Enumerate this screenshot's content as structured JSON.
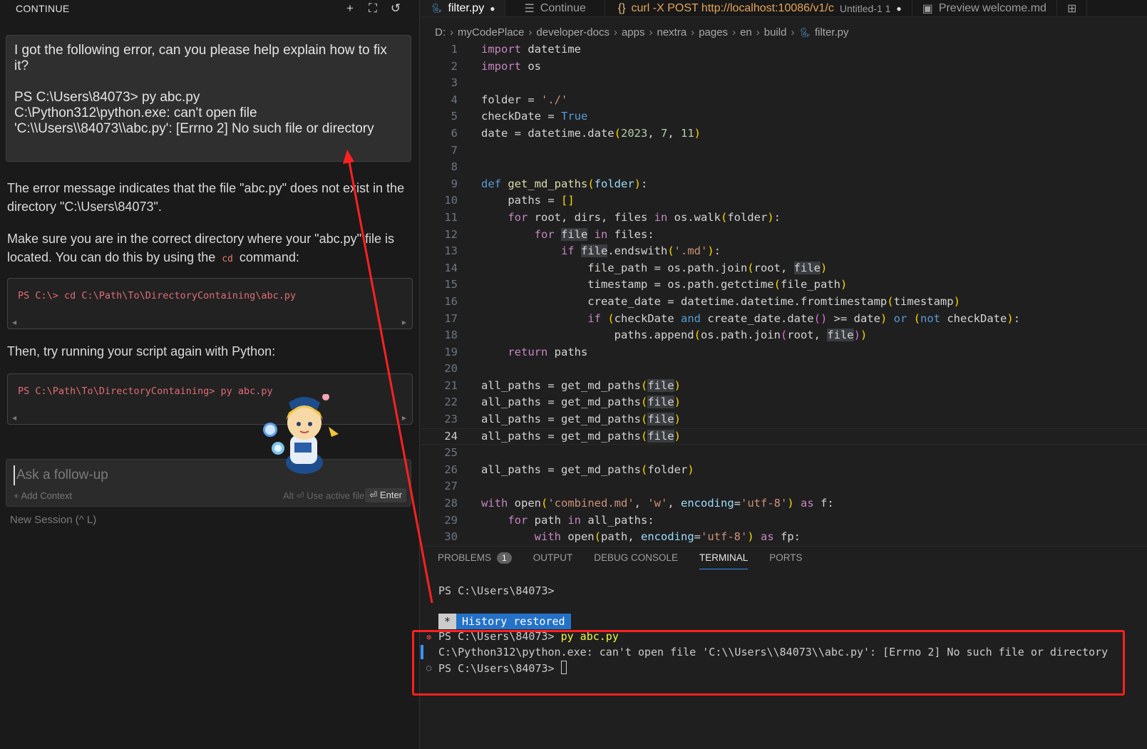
{
  "continue_panel": {
    "title": "CONTINUE",
    "actions": [
      {
        "name": "new-session-icon",
        "glyph": "+"
      },
      {
        "name": "fullscreen-icon",
        "glyph": "⛶"
      },
      {
        "name": "history-icon",
        "glyph": "↺"
      }
    ],
    "user_message": {
      "line1": "I got the following error, can you please help explain how to fix it?",
      "line2": "PS C:\\Users\\84073> py abc.py",
      "line3": "C:\\Python312\\python.exe: can't open file",
      "line4": "'C:\\\\Users\\\\84073\\\\abc.py': [Errno 2] No such file or directory"
    },
    "answer": {
      "p1": "The error message indicates that the file \"abc.py\" does not exist in the directory \"C:\\Users\\84073\".",
      "p2_a": "Make sure you are in the correct directory where your \"abc.py\" file is located. You can do this by using the ",
      "p2_code": "cd",
      "p2_b": " command:",
      "code1": "PS C:\\> cd C:\\Path\\To\\DirectoryContaining\\abc.py",
      "p3": "Then, try running your script again with Python:",
      "code2": "PS C:\\Path\\To\\DirectoryContaining> py abc.py"
    },
    "followup": {
      "placeholder": "Ask a follow-up",
      "add_context": "+ Add Context",
      "use_active_file": "Alt ⏎ Use active file",
      "enter": "⏎ Enter"
    },
    "new_session": "New Session (^ L)"
  },
  "editor": {
    "tabs": [
      {
        "label": "filter.py",
        "icon": "python-icon",
        "modified": true,
        "active": true
      },
      {
        "label": "Continue",
        "icon": "list-icon",
        "active": false
      },
      {
        "label": "curl -X POST http://localhost:10086/v1/c",
        "sub": "Untitled-1 1",
        "icon": "braces-icon",
        "modified": true,
        "active": false
      },
      {
        "label": "Preview welcome.md",
        "icon": "preview-icon",
        "active": false
      }
    ],
    "breadcrumb": [
      "D:",
      "myCodePlace",
      "developer-docs",
      "apps",
      "nextra",
      "pages",
      "en",
      "build",
      "filter.py"
    ],
    "current_line": 24,
    "line_numbers": [
      "1",
      "2",
      "3",
      "4",
      "5",
      "6",
      "7",
      "8",
      "9",
      "10",
      "11",
      "12",
      "13",
      "14",
      "15",
      "16",
      "17",
      "18",
      "19",
      "20",
      "21",
      "22",
      "23",
      "24",
      "25",
      "26",
      "27",
      "28",
      "29",
      "30"
    ]
  },
  "panel": {
    "tabs": [
      "PROBLEMS",
      "OUTPUT",
      "DEBUG CONSOLE",
      "TERMINAL",
      "PORTS"
    ],
    "problems_count": "1",
    "active_tab": "TERMINAL"
  },
  "terminal": {
    "line1": "PS C:\\Users\\84073>",
    "history_star": "*",
    "history_text": "History restored",
    "prompt": "PS C:\\Users\\84073> ",
    "command": "py abc.py",
    "error": "C:\\Python312\\python.exe: can't open file 'C:\\\\Users\\\\84073\\\\abc.py': [Errno 2] No such file or directory",
    "prompt2": "PS C:\\Users\\84073> "
  },
  "colors": {
    "annotation_red": "#ff2020",
    "accent_blue": "#3794ff"
  }
}
